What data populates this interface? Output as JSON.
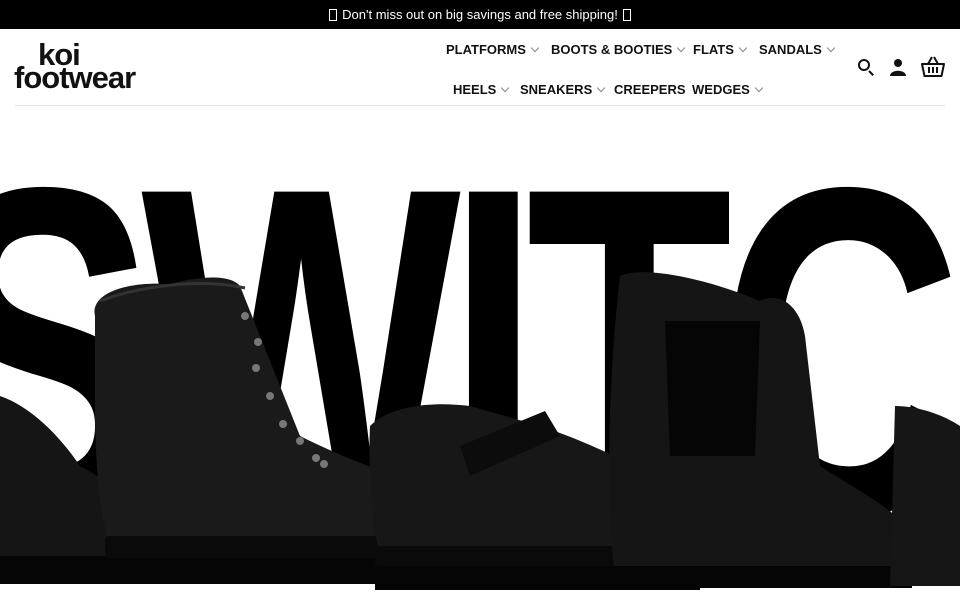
{
  "announcement": {
    "text": "Don't miss out on big savings and free shipping!"
  },
  "brand": {
    "logo_line1": "koi",
    "logo_line2": "footwear"
  },
  "nav": {
    "items": [
      {
        "label": "PLATFORMS",
        "dropdown": true
      },
      {
        "label": "BOOTS & BOOTIES",
        "dropdown": true
      },
      {
        "label": "FLATS",
        "dropdown": true
      },
      {
        "label": "SANDALS",
        "dropdown": true
      },
      {
        "label": "HEELS",
        "dropdown": true
      },
      {
        "label": "SNEAKERS",
        "dropdown": true
      },
      {
        "label": "CREEPERS",
        "dropdown": false
      },
      {
        "label": "WEDGES",
        "dropdown": true
      }
    ]
  },
  "header_icons": [
    "search-icon",
    "account-icon",
    "cart-basket-icon"
  ],
  "hero": {
    "headline": "SWITCH",
    "image": "black-vegan-boots-and-shoes"
  },
  "colors": {
    "topbar_bg": "#000000",
    "text": "#111111",
    "accent": "#000000"
  }
}
